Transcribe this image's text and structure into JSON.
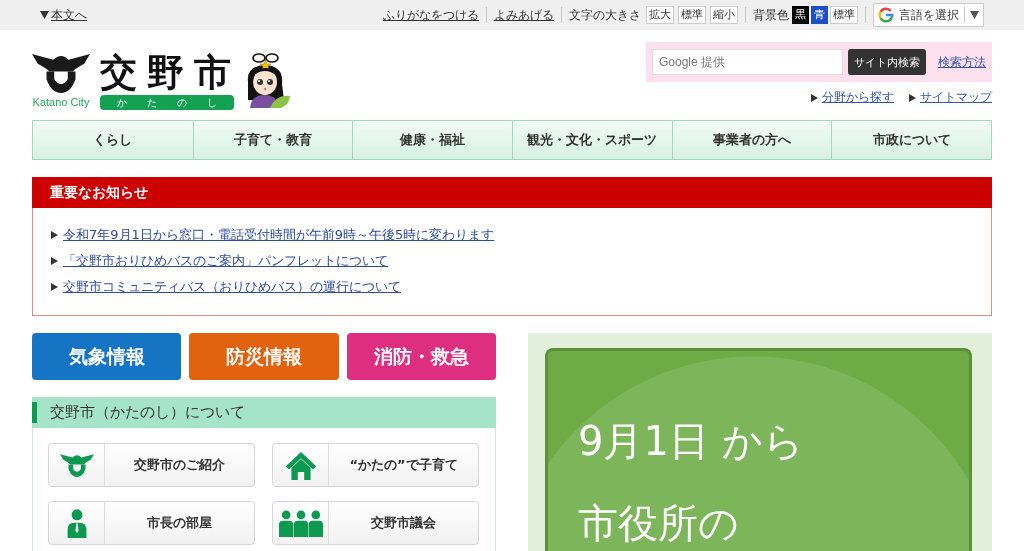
{
  "top_bar": {
    "skip_link": "本文へ",
    "reading_links": [
      "ふりがなをつける",
      "よみあげる"
    ],
    "font_size": {
      "label": "文字の大きさ",
      "buttons": [
        "拡大",
        "標準",
        "縮小"
      ]
    },
    "background_color": {
      "label": "背景色",
      "options": [
        {
          "label": "黒",
          "color": "#000000"
        },
        {
          "label": "青",
          "color": "#1f4fc6"
        },
        {
          "label": "標準",
          "color": "#ffffff"
        }
      ]
    },
    "translate": {
      "label": "言語を選択"
    }
  },
  "header": {
    "emblem_caption": "Katano City",
    "city_name": "交野市",
    "city_reading": "かたのし"
  },
  "search": {
    "placeholder": "Google 提供",
    "button": "サイト内検索",
    "help_link": "検索方法",
    "quick_links": [
      "分野から探す",
      "サイトマップ"
    ]
  },
  "nav": [
    "くらし",
    "子育て・教育",
    "健康・福祉",
    "観光・文化・スポーツ",
    "事業者の方へ",
    "市政について"
  ],
  "notice": {
    "title": "重要なお知らせ",
    "items": [
      "令和7年9月1日から窓口・電話受付時間が午前9時～午後5時に変わります",
      "「交野市おりひめバスのご案内」パンフレットについて",
      "交野市コミュニティバス（おりひめバス）の運行について"
    ]
  },
  "emergency_buttons": [
    {
      "label": "気象情報",
      "color": "#1674c4"
    },
    {
      "label": "防災情報",
      "color": "#e1620f"
    },
    {
      "label": "消防・救急",
      "color": "#dd2e82"
    }
  ],
  "about": {
    "title": "交野市（かたのし）について",
    "tiles": [
      {
        "kind": "emblem",
        "label": "交野市のご紹介"
      },
      {
        "kind": "house",
        "label": "“かたの”で子育て"
      },
      {
        "kind": "person",
        "label": "市長の部屋"
      },
      {
        "kind": "group",
        "label": "交野市議会"
      }
    ]
  },
  "banner": {
    "headline": "9月1日 から",
    "subline": "市役所の"
  }
}
